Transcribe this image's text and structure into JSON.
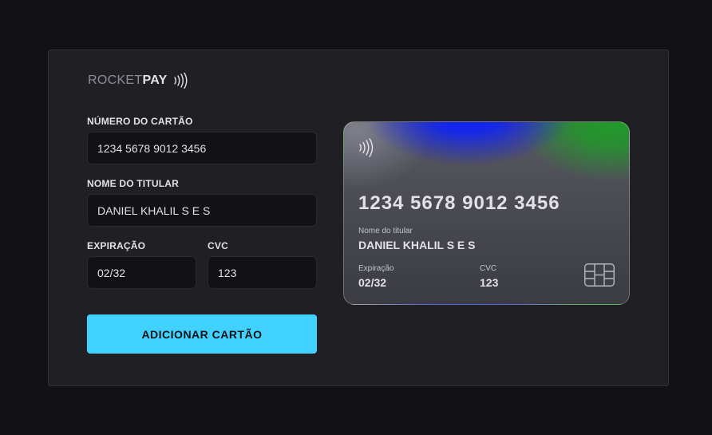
{
  "brand": {
    "part1": "ROCKET",
    "part2": "PAY",
    "icon": "contactless-icon"
  },
  "form": {
    "card_number": {
      "label": "NÚMERO DO CARTÃO",
      "value": "1234 5678 9012 3456"
    },
    "holder_name": {
      "label": "NOME DO TITULAR",
      "value": "DANIEL KHALIL S E S"
    },
    "expiration": {
      "label": "EXPIRAÇÃO",
      "value": "02/32"
    },
    "cvc": {
      "label": "CVC",
      "value": "123"
    },
    "submit_label": "ADICIONAR CARTÃO"
  },
  "card_preview": {
    "number": "1234 5678 9012 3456",
    "holder_label": "Nome do titular",
    "holder_value": "DANIEL KHALIL S E S",
    "expiration_label": "Expiração",
    "expiration_value": "02/32",
    "cvc_label": "CVC",
    "cvc_value": "123",
    "icons": [
      "contactless-icon",
      "chip-icon"
    ]
  },
  "colors": {
    "page_bg": "#121214",
    "panel_bg": "#202024",
    "input_bg": "#121214",
    "accent": "#40d1ff",
    "card_blue": "#0a1fff",
    "card_green": "#1f9a28"
  }
}
